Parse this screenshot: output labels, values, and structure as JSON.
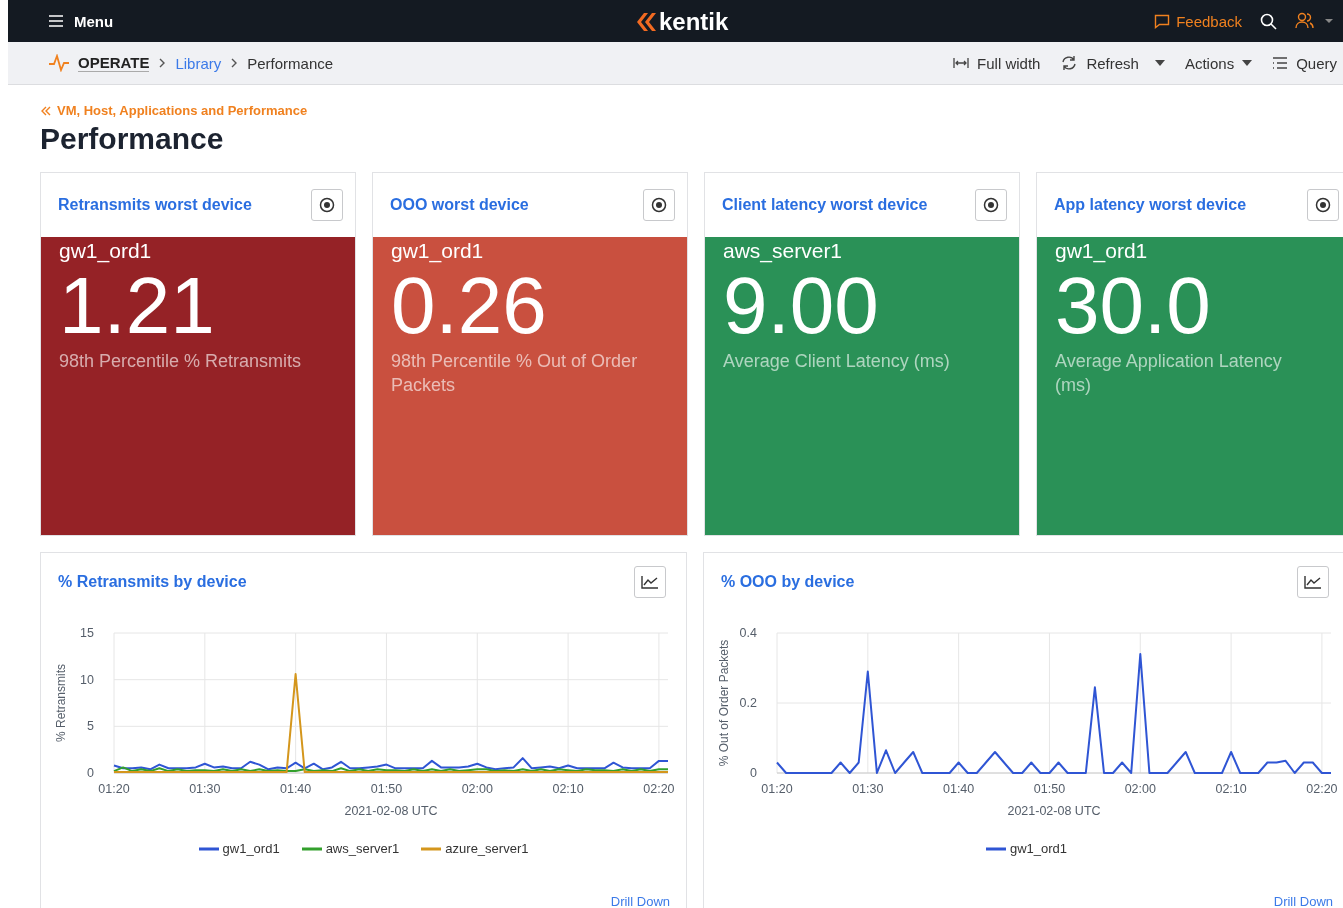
{
  "topbar": {
    "menu_label": "Menu",
    "logo": "kentik",
    "feedback": "Feedback"
  },
  "breadcrumb": {
    "section": "OPERATE",
    "items": [
      {
        "label": "Library",
        "link": true
      },
      {
        "label": "Performance",
        "link": false
      }
    ]
  },
  "toolbar": [
    {
      "label": "Full width",
      "kind": "width"
    },
    {
      "label": "Refresh",
      "kind": "refresh"
    },
    {
      "label": "Actions",
      "kind": "actions"
    },
    {
      "label": "Query",
      "kind": "query"
    }
  ],
  "parent_link": "VM, Host, Applications and Performance",
  "page_title": "Performance",
  "stat_cards": [
    {
      "title": "Retransmits worst device",
      "device": "gw1_ord1",
      "value": "1.21",
      "caption": "98th Percentile % Retransmits",
      "color": "#952226"
    },
    {
      "title": "OOO worst device",
      "device": "gw1_ord1",
      "value": "0.26",
      "caption": "98th Percentile % Out of Order Packets",
      "color": "#c9503f"
    },
    {
      "title": "Client latency worst device",
      "device": "aws_server1",
      "value": "9.00",
      "caption": "Average Client Latency (ms)",
      "color": "#2a9157"
    },
    {
      "title": "App latency worst device",
      "device": "gw1_ord1",
      "value": "30.0",
      "caption": "Average Application Latency (ms)",
      "color": "#2a9157"
    }
  ],
  "chart_cards": [
    {
      "title": "% Retransmits by device",
      "drill_down": "Drill Down",
      "chart_data": {
        "type": "line",
        "grid": true,
        "xlabel": "2021-02-08 UTC",
        "ylabel": "% Retransmits",
        "ylim": [
          0,
          15
        ],
        "yticks": [
          0,
          5,
          10,
          15
        ],
        "categories": [
          "01:20",
          null,
          null,
          null,
          null,
          null,
          null,
          null,
          null,
          null,
          "01:30",
          null,
          null,
          null,
          null,
          null,
          null,
          null,
          null,
          null,
          "01:40",
          null,
          null,
          null,
          null,
          null,
          null,
          null,
          null,
          null,
          "01:50",
          null,
          null,
          null,
          null,
          null,
          null,
          null,
          null,
          null,
          "02:00",
          null,
          null,
          null,
          null,
          null,
          null,
          null,
          null,
          null,
          "02:10",
          null,
          null,
          null,
          null,
          null,
          null,
          null,
          null,
          null,
          "02:20",
          null
        ],
        "series": [
          {
            "name": "gw1_ord1",
            "color": "#2f55d4",
            "values": [
              0.8,
              0.5,
              0.5,
              0.6,
              0.4,
              0.9,
              0.5,
              0.5,
              0.5,
              0.6,
              1.0,
              0.6,
              0.7,
              0.5,
              0.5,
              1.2,
              0.9,
              0.4,
              0.6,
              0.5,
              1.1,
              0.5,
              1.0,
              0.4,
              0.6,
              1.2,
              0.5,
              0.5,
              0.6,
              0.7,
              0.9,
              0.5,
              0.5,
              0.5,
              0.5,
              1.3,
              0.6,
              0.6,
              0.6,
              0.7,
              1.0,
              0.6,
              0.4,
              0.5,
              0.6,
              1.6,
              0.5,
              0.6,
              0.7,
              0.5,
              0.8,
              0.5,
              0.5,
              0.5,
              0.5,
              1.1,
              0.6,
              0.5,
              0.5,
              0.5,
              1.3,
              1.3
            ]
          },
          {
            "name": "aws_server1",
            "color": "#33a02c",
            "values": [
              0.2,
              0.6,
              0.2,
              0.4,
              0.2,
              0.5,
              0.2,
              0.4,
              0.2,
              0.3,
              0.3,
              0.2,
              0.4,
              0.2,
              0.4,
              0.2,
              0.4,
              0.2,
              0.3,
              0.2,
              0.2,
              0.4,
              0.2,
              0.3,
              0.2,
              0.5,
              0.2,
              0.4,
              0.2,
              0.4,
              0.3,
              0.3,
              0.2,
              0.4,
              0.2,
              0.4,
              0.2,
              0.4,
              0.2,
              0.3,
              0.4,
              0.4,
              0.2,
              0.3,
              0.2,
              0.4,
              0.2,
              0.4,
              0.2,
              0.4,
              0.3,
              0.2,
              0.4,
              0.3,
              0.3,
              0.2,
              0.4,
              0.2,
              0.4,
              0.2,
              0.4,
              0.4
            ]
          },
          {
            "name": "azure_server1",
            "color": "#d4961c",
            "values": [
              0.1,
              0.1,
              0.1,
              0.1,
              0.1,
              0.1,
              0.1,
              0.1,
              0.1,
              0.1,
              0.1,
              0.1,
              0.1,
              0.1,
              0.1,
              0.1,
              0.1,
              0.1,
              0.1,
              0.1,
              10.6,
              0.1,
              0.1,
              0.1,
              0.1,
              0.1,
              0.1,
              0.1,
              0.1,
              0.1,
              0.1,
              0.1,
              0.1,
              0.1,
              0.1,
              0.1,
              0.1,
              0.1,
              0.1,
              0.1,
              0.1,
              0.1,
              0.1,
              0.1,
              0.1,
              0.1,
              0.1,
              0.1,
              0.1,
              0.1,
              0.1,
              0.1,
              0.1,
              0.1,
              0.1,
              0.1,
              0.1,
              0.1,
              0.1,
              0.1,
              0.1,
              0.1
            ]
          }
        ]
      }
    },
    {
      "title": "% OOO by device",
      "drill_down": "Drill Down",
      "chart_data": {
        "type": "line",
        "grid": true,
        "xlabel": "2021-02-08 UTC",
        "ylabel": "% Out of Order Packets",
        "ylim": [
          0,
          0.4
        ],
        "yticks": [
          0,
          0.2,
          0.4
        ],
        "categories": [
          "01:20",
          null,
          null,
          null,
          null,
          null,
          null,
          null,
          null,
          null,
          "01:30",
          null,
          null,
          null,
          null,
          null,
          null,
          null,
          null,
          null,
          "01:40",
          null,
          null,
          null,
          null,
          null,
          null,
          null,
          null,
          null,
          "01:50",
          null,
          null,
          null,
          null,
          null,
          null,
          null,
          null,
          null,
          "02:00",
          null,
          null,
          null,
          null,
          null,
          null,
          null,
          null,
          null,
          "02:10",
          null,
          null,
          null,
          null,
          null,
          null,
          null,
          null,
          null,
          "02:20",
          null
        ],
        "series": [
          {
            "name": "gw1_ord1",
            "color": "#2f55d4",
            "values": [
              0.03,
              0,
              0,
              0,
              0,
              0,
              0,
              0.03,
              0,
              0.03,
              0.29,
              0,
              0.065,
              0,
              0.03,
              0.06,
              0,
              0,
              0,
              0,
              0.03,
              0,
              0,
              0.03,
              0.06,
              0.03,
              0,
              0,
              0.03,
              0,
              0,
              0.03,
              0,
              0,
              0,
              0.245,
              0,
              0,
              0.03,
              0,
              0.34,
              0,
              0,
              0,
              0.03,
              0.06,
              0,
              0,
              0,
              0,
              0.06,
              0,
              0,
              0,
              0.03,
              0.03,
              0.035,
              0,
              0.03,
              0.03,
              0,
              0
            ]
          }
        ]
      }
    }
  ]
}
